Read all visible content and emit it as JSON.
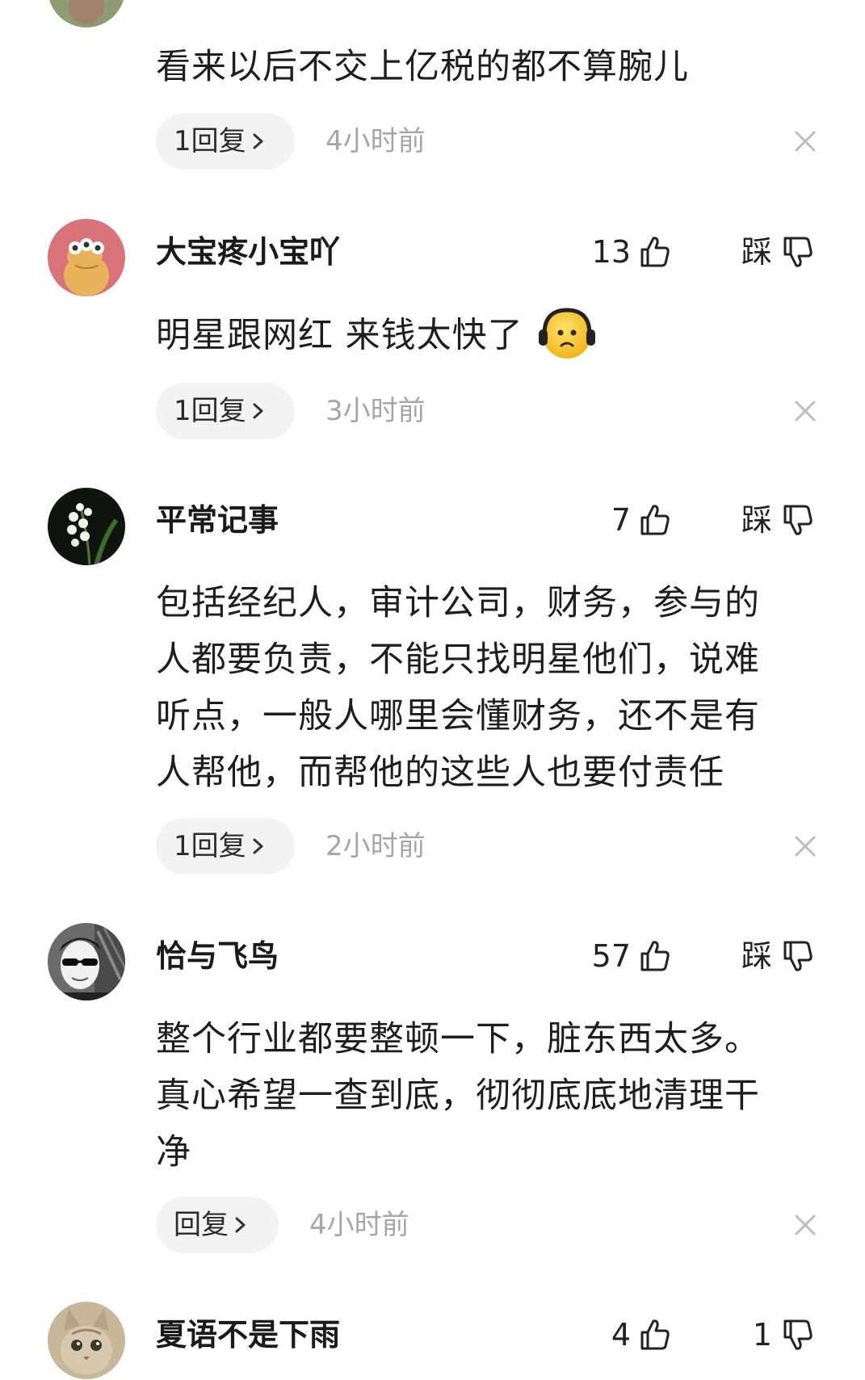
{
  "colors": {
    "background": "#ffffff",
    "text_primary": "#1e1e1e",
    "timestamp": "#a6a6a6",
    "reply_pill_bg": "#f3f3f3",
    "close_icon": "#bdbdbd"
  },
  "comments": [
    {
      "username": "",
      "text": "看来以后不交上亿税的都不算腕儿",
      "reply_label": "1回复",
      "time": "4小时前",
      "avatar_icon": "avatar-green-partial"
    },
    {
      "username": "大宝疼小宝吖",
      "likes": "13",
      "dislike_label": "踩",
      "text": "明星跟网红 来钱太快了",
      "emoji": "headphone-face-emoji",
      "reply_label": "1回复",
      "time": "3小时前",
      "avatar_icon": "avatar-cartoon-frog"
    },
    {
      "username": "平常记事",
      "likes": "7",
      "dislike_label": "踩",
      "text_lines": [
        "包括经纪人，审计公司，财务，参与的",
        "人都要负责，不能只找明星他们，说难",
        "听点，一般人哪里会懂财务，还不是有",
        "人帮他，而帮他的这些人也要付责任"
      ],
      "reply_label": "1回复",
      "time": "2小时前",
      "avatar_icon": "avatar-lily-of-valley"
    },
    {
      "username": "恰与飞鸟",
      "likes": "57",
      "dislike_label": "踩",
      "text_lines": [
        "整个行业都要整顿一下，脏东西太多。",
        "真心希望一查到底，彻彻底底地清理干",
        "净"
      ],
      "reply_label": "回复",
      "time": "4小时前",
      "avatar_icon": "avatar-man-sunglasses"
    },
    {
      "username": "夏语不是下雨",
      "likes": "4",
      "dislikes": "1",
      "avatar_icon": "avatar-cat"
    }
  ]
}
